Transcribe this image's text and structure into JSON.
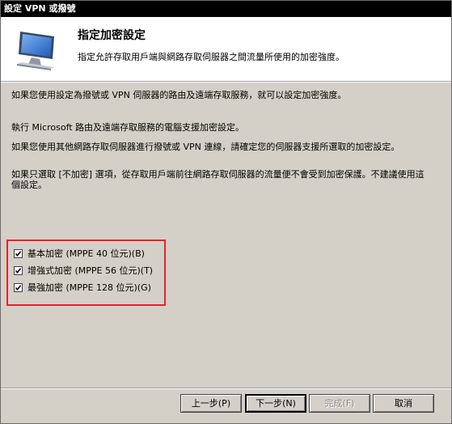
{
  "window": {
    "title": "設定 VPN 或撥號"
  },
  "header": {
    "title": "指定加密設定",
    "subtitle": "指定允許存取用戶端與網路存取伺服器之間流量所使用的加密強度。",
    "icon": "monitor-icon"
  },
  "body": {
    "paragraph1": "如果您使用設定為撥號或 VPN 伺服器的路由及遠端存取服務，就可以設定加密強度。",
    "paragraph2": "執行 Microsoft 路由及遠端存取服務的電腦支援加密設定。",
    "paragraph3": "如果您使用其他網路存取伺服器進行撥號或 VPN 連線，請確定您的伺服器支援所選取的加密設定。",
    "paragraph4": "如果只選取 [不加密] 選項，從存取用戶端前往網路存取伺服器的流量便不會受到加密保護。不建議使用這個設定。"
  },
  "options": [
    {
      "label": "基本加密 (MPPE 40 位元)(B)",
      "checked": true
    },
    {
      "label": "增強式加密 (MPPE 56 位元)(T)",
      "checked": true
    },
    {
      "label": "最強加密 (MPPE 128 位元)(G)",
      "checked": true
    }
  ],
  "buttons": {
    "back": "上一步(P)",
    "next": "下一步(N)",
    "finish": "完成(F)",
    "cancel": "取消"
  },
  "colors": {
    "highlight": "#e0252e",
    "titlebar": "#000000",
    "dialog_bg": "#d4d0c8"
  }
}
